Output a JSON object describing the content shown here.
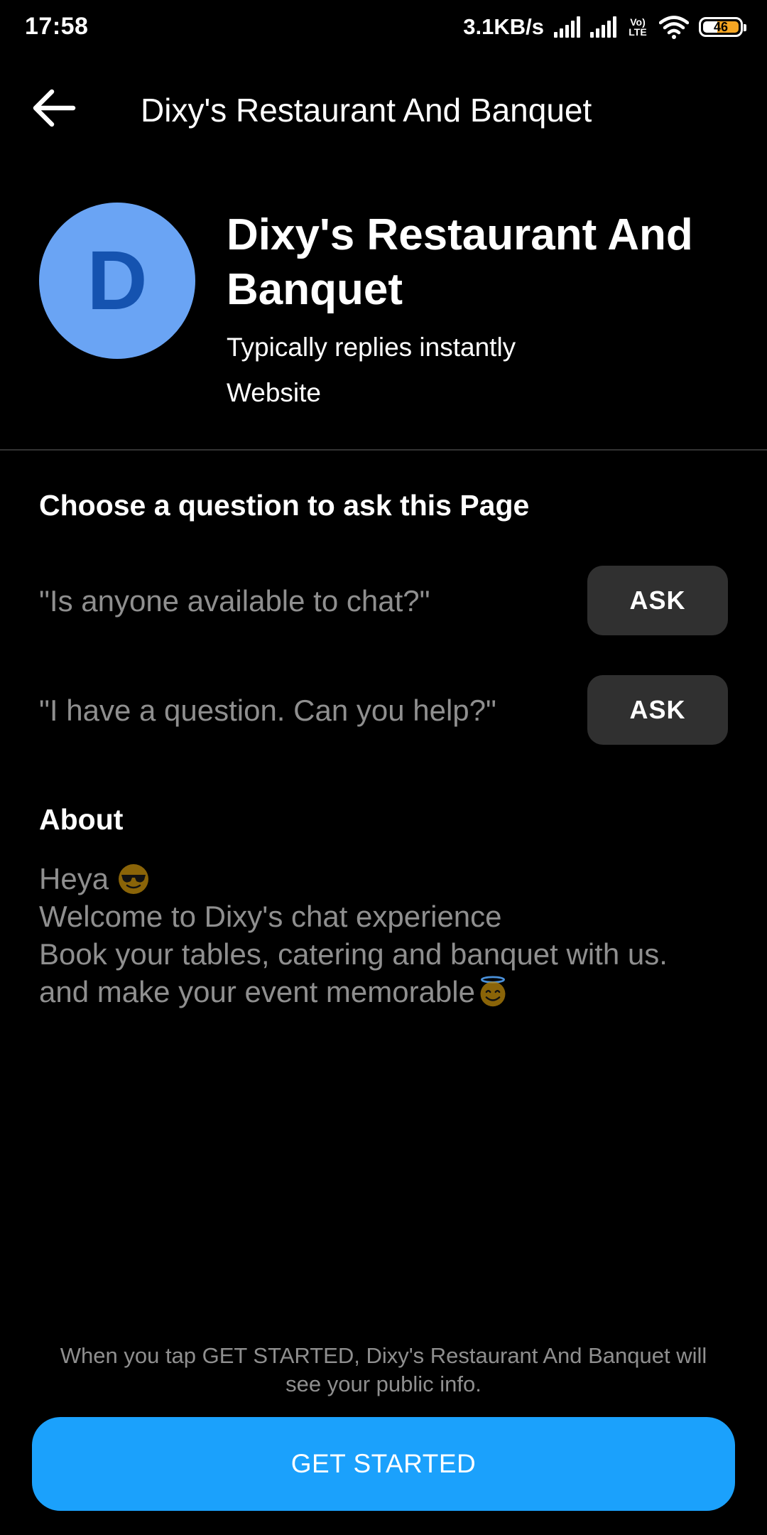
{
  "status_bar": {
    "time": "17:58",
    "net_speed": "3.1KB/s",
    "volte_top": "Vo)",
    "volte_bottom": "LTE",
    "battery": "46"
  },
  "header": {
    "title": "Dixy's Restaurant And Banquet",
    "back_icon": "arrow-left-icon"
  },
  "profile": {
    "avatar_letter": "D",
    "avatar_color": "#6aa4f4",
    "avatar_letter_color": "#1553b0",
    "name": "Dixy's Restaurant And Banquet",
    "reply_time": "Typically replies instantly",
    "website": "Website"
  },
  "questions": {
    "title": "Choose a question to ask this Page",
    "items": [
      {
        "text": "\"Is anyone available to chat?\"",
        "button": "ASK"
      },
      {
        "text": "\"I have a question. Can you help?\"",
        "button": "ASK"
      }
    ]
  },
  "about": {
    "title": "About",
    "lines": [
      "Heya",
      "Welcome to Dixy's chat experience",
      "Book your tables, catering and banquet with us.",
      "and make your event memorable"
    ],
    "emojis": [
      "sunglasses-face-icon",
      "halo-face-icon"
    ]
  },
  "footer": {
    "disclaimer": "When you tap GET STARTED, Dixy's Restaurant And Banquet will see your public info.",
    "button": "GET STARTED",
    "button_color": "#1ba1fc"
  }
}
